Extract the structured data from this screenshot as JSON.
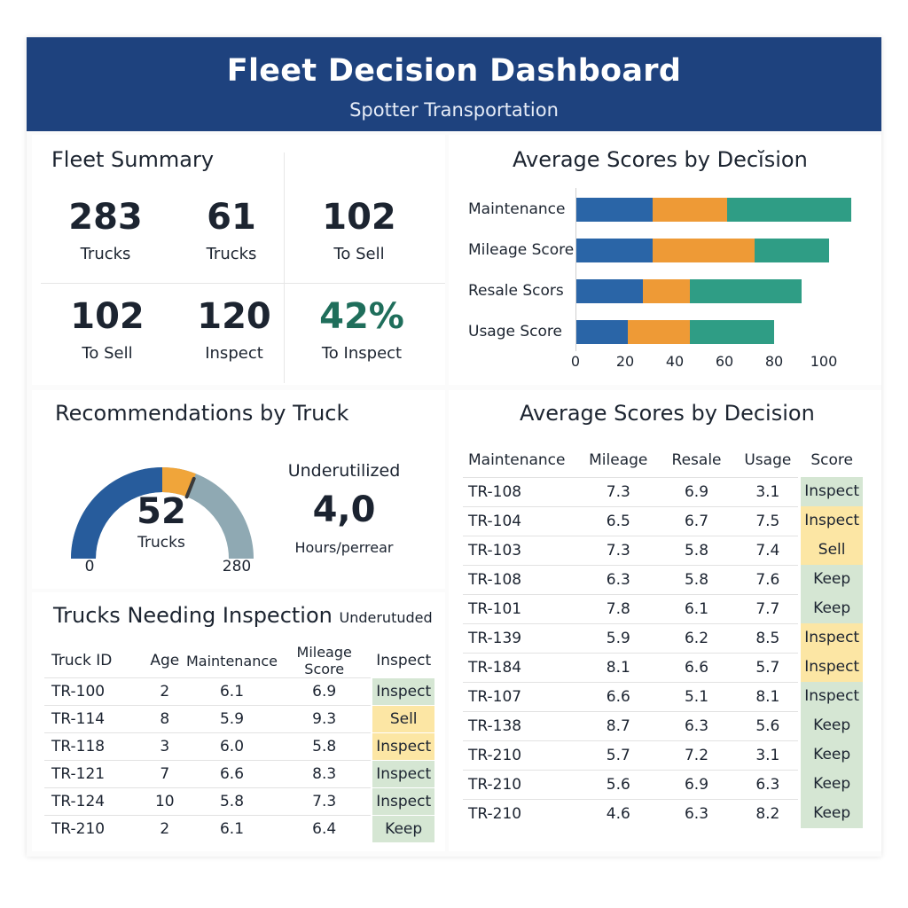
{
  "header": {
    "title": "Fleet Decision Dashboard",
    "subtitle": "Spotter Transportation"
  },
  "summary": {
    "title": "Fleet Summary",
    "kpis": [
      {
        "value": "283",
        "label": "Trucks"
      },
      {
        "value": "61",
        "label": "Trucks"
      },
      {
        "value": "102",
        "label": "To Sell"
      },
      {
        "value": "102",
        "label": "To Sell"
      },
      {
        "value": "120",
        "label": "Inspect"
      },
      {
        "value": "42%",
        "label": "To Inspect"
      }
    ]
  },
  "avg_chart": {
    "title": "Average Scores by Decĭsion",
    "colors": {
      "blue": "#2a65a7",
      "orange": "#ee9a36",
      "teal": "#2f9d85"
    }
  },
  "chart_data": {
    "type": "bar",
    "orientation": "horizontal",
    "stacked": true,
    "title": "Average Scores by Decĭsion",
    "categories": [
      "Maintenance",
      "Mileage Score",
      "Resale Scors",
      "Usage Score"
    ],
    "series": [
      {
        "values": [
          31,
          31,
          27,
          21
        ]
      },
      {
        "values": [
          30,
          41,
          19,
          25
        ]
      },
      {
        "values": [
          50,
          30,
          45,
          34
        ]
      }
    ],
    "xlim": [
      0,
      120
    ],
    "xticks": [
      "0",
      "20",
      "40",
      "60",
      "80",
      "100"
    ],
    "grid": false
  },
  "recommendations": {
    "title": "Recommendations by Truck",
    "gauge": {
      "value": "52",
      "unit": "Trucks",
      "min": "0",
      "max": "280",
      "fill_fraction": 0.62
    },
    "side_label": "Underutilized",
    "side_value": "4,0",
    "side_unit": "Hours/perrear"
  },
  "inspection": {
    "title": "Trucks Needing Inspection",
    "title_suffix": "Underutuded",
    "columns": [
      "Truck ID",
      "Age",
      "Maintenance",
      "Mileage Score",
      "Inspect"
    ],
    "rows": [
      {
        "id": "TR-100",
        "age": "2",
        "maint": "6.1",
        "mileage": "6.9",
        "rec": "Inspect",
        "style": "inspect"
      },
      {
        "id": "TR-114",
        "age": "8",
        "maint": "5.9",
        "mileage": "9.3",
        "rec": "Sell",
        "style": "sell"
      },
      {
        "id": "TR-118",
        "age": "3",
        "maint": "6.0",
        "mileage": "5.8",
        "rec": "Inspect",
        "style": "inspect-y"
      },
      {
        "id": "TR-121",
        "age": "7",
        "maint": "6.6",
        "mileage": "8.3",
        "rec": "Inspect",
        "style": "inspect"
      },
      {
        "id": "TR-124",
        "age": "10",
        "maint": "5.8",
        "mileage": "7.3",
        "rec": "Inspect",
        "style": "inspect"
      },
      {
        "id": "TR-210",
        "age": "2",
        "maint": "6.1",
        "mileage": "6.4",
        "rec": "Keep",
        "style": "keep"
      }
    ]
  },
  "decision_table": {
    "title": "Average Scores by Decision",
    "columns": [
      "Maintenance",
      "Mileage",
      "Resale",
      "Usage",
      "Score"
    ],
    "rows": [
      {
        "id": "TR-108",
        "mileage": "7.3",
        "resale": "6.9",
        "usage": "3.1",
        "score": "Inspect",
        "style": "inspect"
      },
      {
        "id": "TR-104",
        "mileage": "6.5",
        "resale": "6.7",
        "usage": "7.5",
        "score": "Inspect",
        "style": "inspect-y"
      },
      {
        "id": "TR-103",
        "mileage": "7.3",
        "resale": "5.8",
        "usage": "7.4",
        "score": "Sell",
        "style": "sell"
      },
      {
        "id": "TR-108",
        "mileage": "6.3",
        "resale": "5.8",
        "usage": "7.6",
        "score": "Keep",
        "style": "keep"
      },
      {
        "id": "TR-101",
        "mileage": "7.8",
        "resale": "6.1",
        "usage": "7.7",
        "score": "Keep",
        "style": "keep"
      },
      {
        "id": "TR-139",
        "mileage": "5.9",
        "resale": "6.2",
        "usage": "8.5",
        "score": "Inspect",
        "style": "inspect-y"
      },
      {
        "id": "TR-184",
        "mileage": "8.1",
        "resale": "6.6",
        "usage": "5.7",
        "score": "Inspect",
        "style": "inspect-y"
      },
      {
        "id": "TR-107",
        "mileage": "6.6",
        "resale": "5.1",
        "usage": "8.1",
        "score": "Inspect",
        "style": "inspect"
      },
      {
        "id": "TR-138",
        "mileage": "8.7",
        "resale": "6.3",
        "usage": "5.6",
        "score": "Keep",
        "style": "keep"
      },
      {
        "id": "TR-210",
        "mileage": "5.7",
        "resale": "7.2",
        "usage": "3.1",
        "score": "Keep",
        "style": "keep"
      },
      {
        "id": "TR-210",
        "mileage": "5.6",
        "resale": "6.9",
        "usage": "6.3",
        "score": "Keep",
        "style": "keep"
      },
      {
        "id": "TR-210",
        "mileage": "4.6",
        "resale": "6.3",
        "usage": "8.2",
        "score": "Keep",
        "style": "keep"
      }
    ]
  }
}
